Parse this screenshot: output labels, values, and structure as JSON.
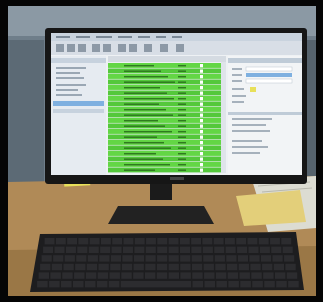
{
  "scene": {
    "subject": "monitor-on-desk-with-keyboard",
    "colors": {
      "frame": "#050505",
      "wall": "#6f7e8a",
      "ceiling_wall": "#8b99a4",
      "desk": "#b08a57",
      "desk_dark": "#7d5f37",
      "bezel": "#161616",
      "screen_bg": "#eef1f4",
      "toolbar": "#d8dee6",
      "title_bar": "#c9d3de",
      "sidebar": "#e6ebf1",
      "sidebar_accent": "#7fb0e0",
      "table_green": "#63d645",
      "table_green_alt": "#54c83b",
      "right_panel": "#f2f4f6",
      "keyboard": "#1d1d1f",
      "key": "#2c2c2f",
      "sticky_note": "#e8e05a",
      "papers": "#dcdcd2",
      "folder_yellow": "#e3cf7a"
    },
    "table_rows": 20
  }
}
